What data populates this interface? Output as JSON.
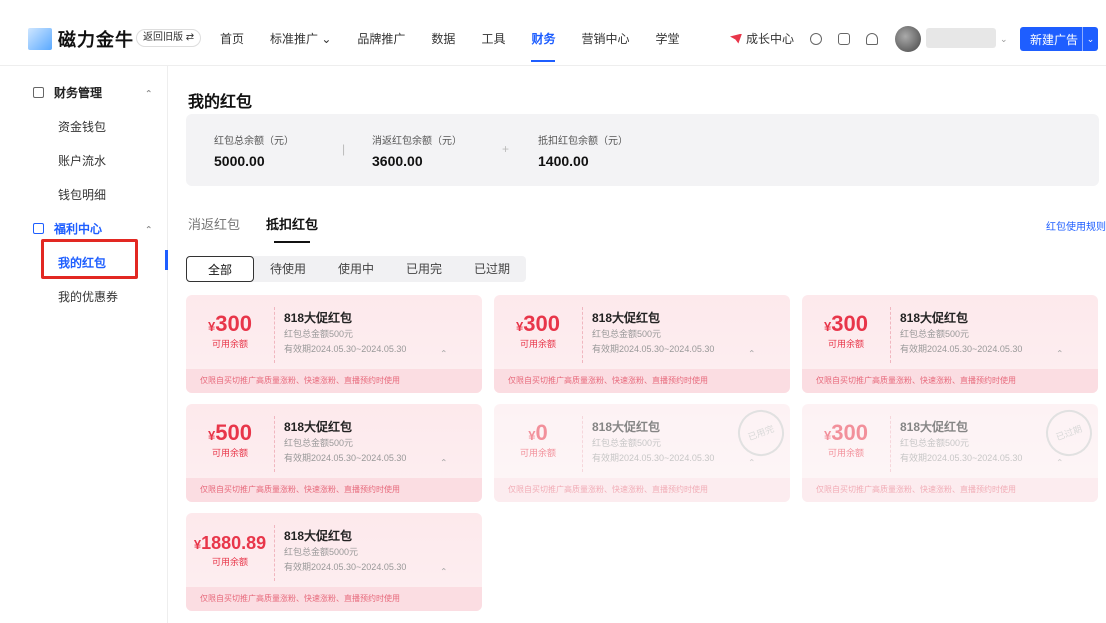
{
  "header": {
    "brand": "磁力金牛",
    "old_version": "返回旧版 ⇄",
    "nav": [
      {
        "label": "首页",
        "active": false
      },
      {
        "label": "标准推广 ⌄",
        "active": false
      },
      {
        "label": "品牌推广",
        "active": false
      },
      {
        "label": "数据",
        "active": false
      },
      {
        "label": "工具",
        "active": false
      },
      {
        "label": "财务",
        "active": true
      },
      {
        "label": "营销中心",
        "active": false
      },
      {
        "label": "学堂",
        "active": false
      }
    ],
    "growth_center": "成长中心",
    "new_ad_button": "新建广告"
  },
  "sidebar": {
    "groups": [
      {
        "label": "财务管理",
        "items": [
          "资金钱包",
          "账户流水",
          "钱包明细"
        ]
      },
      {
        "label": "福利中心",
        "items": [
          "我的红包",
          "我的优惠券"
        ]
      }
    ],
    "active_item": "我的红包"
  },
  "main": {
    "title": "我的红包",
    "summary": [
      {
        "label": "红包总余额（元）",
        "value": "5000.00"
      },
      {
        "label": "消返红包余额（元）",
        "value": "3600.00"
      },
      {
        "label": "抵扣红包余额（元）",
        "value": "1400.00"
      }
    ],
    "summary_sep": [
      "|",
      "+"
    ],
    "tabs": [
      "消返红包",
      "抵扣红包"
    ],
    "active_tab": "抵扣红包",
    "rule_link": "红包使用规则",
    "filters": [
      "全部",
      "待使用",
      "使用中",
      "已用完",
      "已过期"
    ],
    "active_filter": "全部",
    "cards": [
      {
        "yen": "¥",
        "amount": "300",
        "avail": "可用余额",
        "title": "818大促红包",
        "total": "红包总金额500元",
        "valid": "有效期2024.05.30~2024.05.30",
        "note": "仅限自买切推广高质量涨粉、快速涨粉、直播预约时使用",
        "dim": false
      },
      {
        "yen": "¥",
        "amount": "300",
        "avail": "可用余额",
        "title": "818大促红包",
        "total": "红包总金额500元",
        "valid": "有效期2024.05.30~2024.05.30",
        "note": "仅限自买切推广高质量涨粉、快速涨粉、直播预约时使用",
        "dim": false
      },
      {
        "yen": "¥",
        "amount": "300",
        "avail": "可用余额",
        "title": "818大促红包",
        "total": "红包总金额500元",
        "valid": "有效期2024.05.30~2024.05.30",
        "note": "仅限自买切推广高质量涨粉、快速涨粉、直播预约时使用",
        "dim": false
      },
      {
        "yen": "¥",
        "amount": "500",
        "avail": "可用余额",
        "title": "818大促红包",
        "total": "红包总金额500元",
        "valid": "有效期2024.05.30~2024.05.30",
        "note": "仅限自买切推广高质量涨粉、快速涨粉、直播预约时使用",
        "dim": false
      },
      {
        "yen": "¥",
        "amount": "0",
        "avail": "可用余额",
        "title": "818大促红包",
        "total": "红包总金额500元",
        "valid": "有效期2024.05.30~2024.05.30",
        "note": "仅限自买切推广高质量涨粉、快速涨粉、直播预约时使用",
        "dim": true,
        "stamp": "已用完"
      },
      {
        "yen": "¥",
        "amount": "300",
        "avail": "可用余额",
        "title": "818大促红包",
        "total": "红包总金额500元",
        "valid": "有效期2024.05.30~2024.05.30",
        "note": "仅限自买切推广高质量涨粉、快速涨粉、直播预约时使用",
        "dim": true,
        "stamp": "已过期"
      },
      {
        "yen": "¥",
        "amount": "1880.89",
        "avail": "可用余额",
        "title": "818大促红包",
        "total": "红包总金额5000元",
        "valid": "有效期2024.05.30~2024.05.30",
        "note": "仅限自买切推广高质量涨粉、快速涨粉、直播预约时使用",
        "dim": false
      }
    ]
  },
  "colors": {
    "accent": "#1e5eff",
    "red": "#e8364a",
    "card_bg": "#fde9ec",
    "highlight_box": "#e22822"
  },
  "icons": [
    "logo-icon",
    "growth-icon",
    "help-icon",
    "edit-icon",
    "bell-icon",
    "avatar",
    "wallet-icon",
    "gift-icon",
    "chevron-up-icon"
  ]
}
